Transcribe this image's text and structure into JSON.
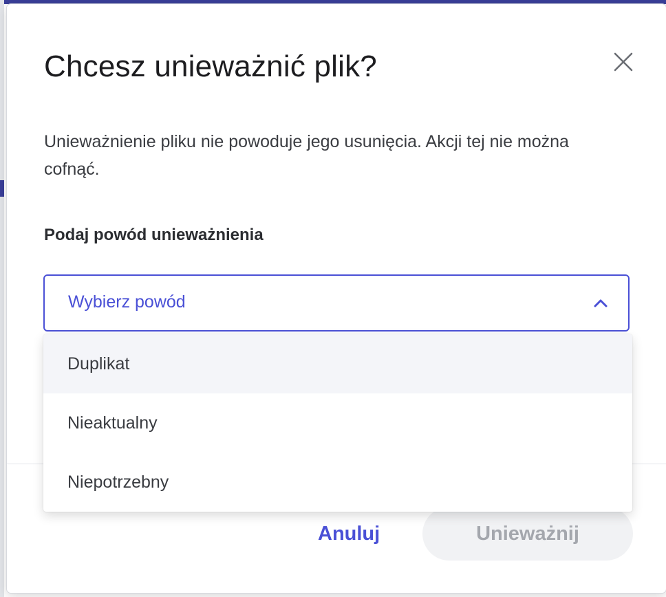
{
  "dialog": {
    "title": "Chcesz unieważnić plik?",
    "description": "Unieważnienie pliku nie powoduje jego usunięcia. Akcji tej nie można cofnąć.",
    "close_icon": "close-icon",
    "field_label": "Podaj powód unieważnienia",
    "select": {
      "placeholder": "Wybierz powód",
      "expanded": true,
      "chevron_icon": "chevron-up-icon",
      "options": [
        {
          "label": "Duplikat",
          "highlighted": true
        },
        {
          "label": "Nieaktualny",
          "highlighted": false
        },
        {
          "label": "Niepotrzebny",
          "highlighted": false
        }
      ]
    },
    "actions": {
      "cancel_label": "Anuluj",
      "confirm_label": "Unieważnij",
      "confirm_disabled": true
    }
  },
  "colors": {
    "accent": "#4a50d6",
    "text_primary": "#1c1c1f",
    "disabled_bg": "#f1f2f4",
    "disabled_text": "#a4a7ad",
    "option_highlight": "#f4f5f9"
  }
}
